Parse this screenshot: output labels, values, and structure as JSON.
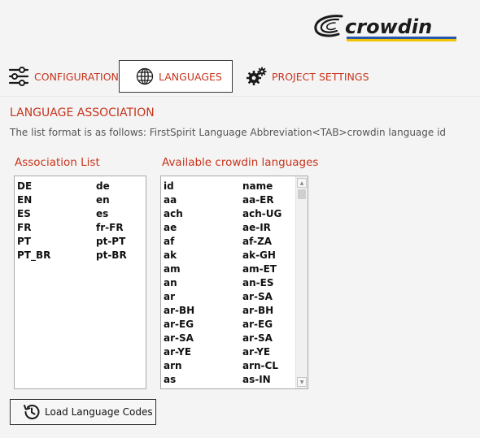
{
  "brand": {
    "logo_text": "crowdin",
    "accent": "#c8351e"
  },
  "tabs": [
    {
      "label": "CONFIGURATION",
      "icon": "sliders-icon",
      "active": false
    },
    {
      "label": "LANGUAGES",
      "icon": "globe-icon",
      "active": true
    },
    {
      "label": "PROJECT SETTINGS",
      "icon": "gears-icon",
      "active": false
    }
  ],
  "section": {
    "title": "LANGUAGE ASSOCIATION",
    "description": "The list format is as follows:  FirstSpirit Language Abbreviation<TAB>crowdin language id"
  },
  "association": {
    "label": "Association List",
    "rows": [
      [
        "DE",
        "de"
      ],
      [
        "EN",
        "en"
      ],
      [
        "ES",
        "es"
      ],
      [
        "FR",
        "fr-FR"
      ],
      [
        "PT",
        "pt-PT"
      ],
      [
        "PT_BR",
        "pt-BR"
      ]
    ]
  },
  "available": {
    "label": "Available crowdin languages",
    "rows": [
      [
        "id",
        "name"
      ],
      [
        "aa",
        "aa-ER"
      ],
      [
        "ach",
        "ach-UG"
      ],
      [
        "ae",
        "ae-IR"
      ],
      [
        "af",
        "af-ZA"
      ],
      [
        "ak",
        "ak-GH"
      ],
      [
        "am",
        "am-ET"
      ],
      [
        "an",
        "an-ES"
      ],
      [
        "ar",
        "ar-SA"
      ],
      [
        "ar-BH",
        "ar-BH"
      ],
      [
        "ar-EG",
        "ar-EG"
      ],
      [
        "ar-SA",
        "ar-SA"
      ],
      [
        "ar-YE",
        "ar-YE"
      ],
      [
        "arn",
        "arn-CL"
      ],
      [
        "as",
        "as-IN"
      ]
    ]
  },
  "load_button": {
    "label": "Load Language Codes",
    "icon": "history-icon"
  }
}
